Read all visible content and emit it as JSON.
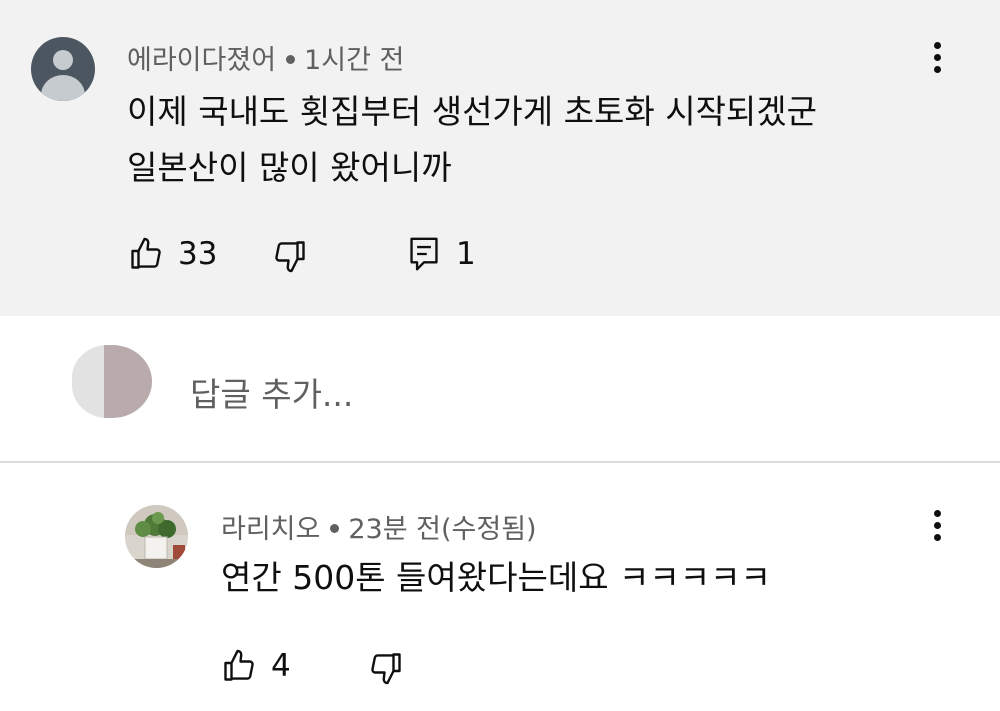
{
  "comment": {
    "author": "에라이다졌어",
    "time": "1시간 전",
    "text_line1": "이제 국내도 횟집부터 생선가게 초토화 시작되겠군",
    "text_line2": "일본산이 많이 왔어니까",
    "likes": "33",
    "replies": "1"
  },
  "reply_box": {
    "placeholder": "답글 추가..."
  },
  "reply": {
    "author": "라리치오",
    "time": "23분 전(수정됨)",
    "text": "연간 500톤 들여왔다는데요 ㅋㅋㅋㅋㅋ",
    "likes": "4"
  },
  "colors": {
    "top_background": "#f2f2f2",
    "meta_text": "#606060",
    "body_text": "#0f0f0f",
    "divider": "#dcdcdc"
  },
  "icons": [
    "default-avatar-icon",
    "more-vert-icon",
    "thumb-up-icon",
    "thumb-down-icon",
    "reply-comment-icon"
  ]
}
